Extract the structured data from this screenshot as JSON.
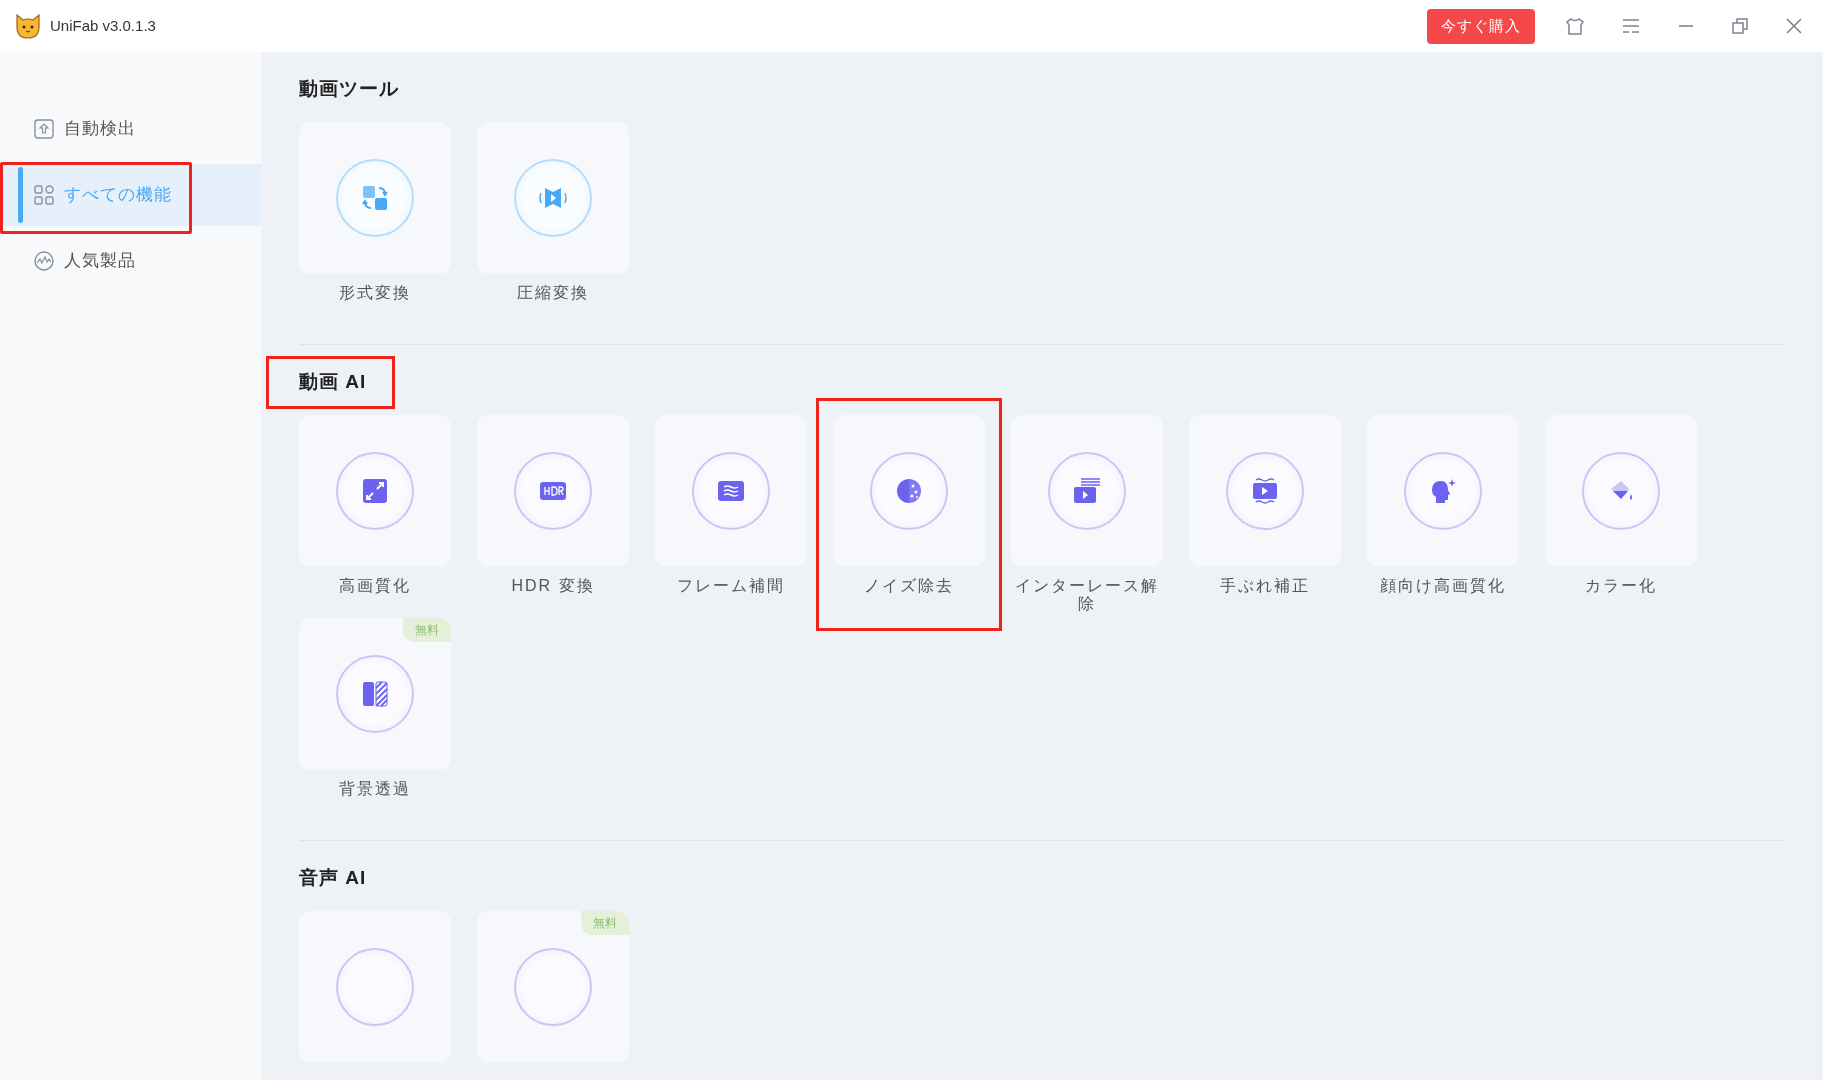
{
  "window": {
    "title": "UniFab v3.0.1.3",
    "buy_button": "今すぐ購入"
  },
  "sidebar": {
    "items": [
      {
        "label": "自動検出",
        "selected": false,
        "highlighted": false
      },
      {
        "label": "すべての機能",
        "selected": true,
        "highlighted": true
      },
      {
        "label": "人気製品",
        "selected": false,
        "highlighted": false
      }
    ]
  },
  "sections": [
    {
      "title": "動画ツール",
      "highlighted": false,
      "tools": [
        {
          "label": "形式変換",
          "highlighted": false
        },
        {
          "label": "圧縮変換",
          "highlighted": false
        }
      ]
    },
    {
      "title": "動画 AI",
      "highlighted": true,
      "tools": [
        {
          "label": "高画質化",
          "highlighted": false
        },
        {
          "label": "HDR 変換",
          "highlighted": false
        },
        {
          "label": "フレーム補間",
          "highlighted": false
        },
        {
          "label": "ノイズ除去",
          "highlighted": true
        },
        {
          "label": "インターレース解除",
          "highlighted": false
        },
        {
          "label": "手ぶれ補正",
          "highlighted": false
        },
        {
          "label": "顔向け高画質化",
          "highlighted": false
        },
        {
          "label": "カラー化",
          "highlighted": false
        },
        {
          "label": "背景透過",
          "highlighted": false,
          "badge": "無料"
        }
      ]
    },
    {
      "title": "音声 AI",
      "highlighted": false,
      "tools": [
        {
          "highlighted": false
        },
        {
          "highlighted": false,
          "badge": "無料"
        }
      ]
    }
  ]
}
